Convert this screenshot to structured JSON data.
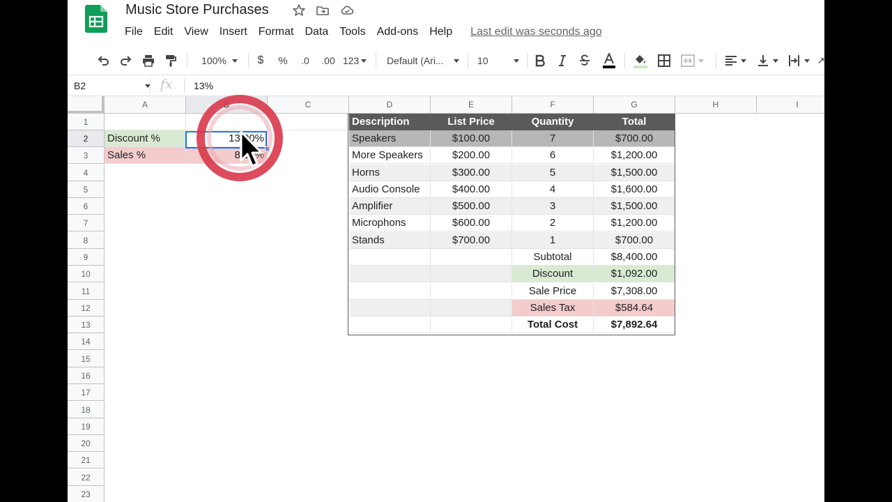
{
  "title": "Music Store Purchases",
  "menus": [
    "File",
    "Edit",
    "View",
    "Insert",
    "Format",
    "Data",
    "Tools",
    "Add-ons",
    "Help"
  ],
  "last_edit": "Last edit was seconds ago",
  "toolbar": {
    "zoom": "100%",
    "currency": "$",
    "percent": "%",
    "dec_decrease": ".0",
    "dec_increase": ".00",
    "more_formats": "123",
    "font": "Default (Ari...",
    "font_size": "10"
  },
  "name_box": "B2",
  "fx_symbol": "fx",
  "formula_value": "13%",
  "columns": [
    "A",
    "B",
    "C",
    "D",
    "E",
    "F",
    "G",
    "H",
    "I"
  ],
  "rows": [
    "1",
    "2",
    "3",
    "4",
    "5",
    "6",
    "7",
    "8",
    "9",
    "10",
    "11",
    "12",
    "13",
    "14",
    "15",
    "16",
    "17",
    "18",
    "19",
    "20",
    "21",
    "22",
    "23"
  ],
  "cells": {
    "A2": "Discount %",
    "B2": "13.00%",
    "A3": "Sales %",
    "B3": "8.00%"
  },
  "table": {
    "headers": [
      "Description",
      "List Price",
      "Quantity",
      "Total"
    ],
    "items": [
      {
        "description": "Speakers",
        "price": "$100.00",
        "qty": "7",
        "total": "$700.00"
      },
      {
        "description": "More Speakers",
        "price": "$200.00",
        "qty": "6",
        "total": "$1,200.00"
      },
      {
        "description": "Horns",
        "price": "$300.00",
        "qty": "5",
        "total": "$1,500.00"
      },
      {
        "description": "Audio Console",
        "price": "$400.00",
        "qty": "4",
        "total": "$1,600.00"
      },
      {
        "description": "Amplifier",
        "price": "$500.00",
        "qty": "3",
        "total": "$1,500.00"
      },
      {
        "description": "Microphons",
        "price": "$600.00",
        "qty": "2",
        "total": "$1,200.00"
      },
      {
        "description": "Stands",
        "price": "$700.00",
        "qty": "1",
        "total": "$700.00"
      }
    ],
    "summary": [
      {
        "label": "Subtotal",
        "value": "$8,400.00"
      },
      {
        "label": "Discount",
        "value": "$1,092.00"
      },
      {
        "label": "Sale Price",
        "value": "$7,308.00"
      },
      {
        "label": "Sales Tax",
        "value": "$584.64"
      },
      {
        "label": "Total Cost",
        "value": "$7,892.64"
      }
    ]
  },
  "colors": {
    "header_fill": "#5a5a5a",
    "highlight_row": "#b7b7b7",
    "band": "#efefef",
    "green": "#d9ead3",
    "pink": "#f4cccc",
    "selection": "#1a73e8",
    "click_ring": "#d9394b"
  }
}
